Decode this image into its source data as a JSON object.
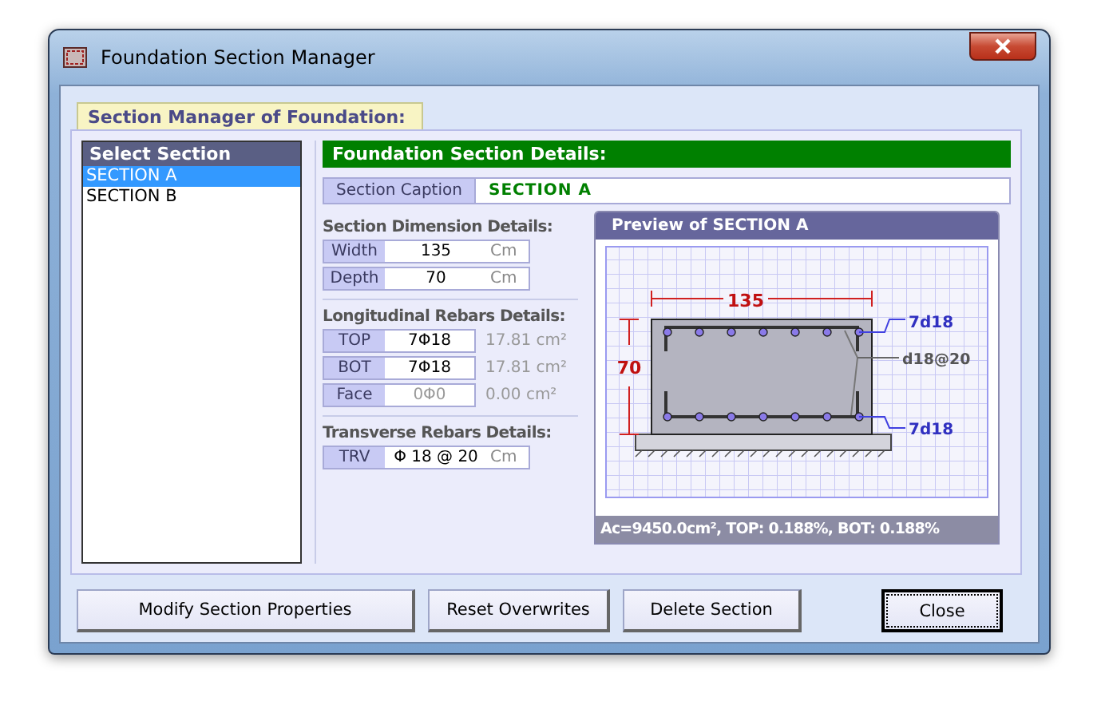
{
  "window": {
    "title": "Foundation Section Manager"
  },
  "group_tab": {
    "label": "Section Manager of Foundation:"
  },
  "section_list": {
    "heading": "Select Section",
    "items": [
      {
        "label": "SECTION A",
        "selected": true
      },
      {
        "label": "SECTION B",
        "selected": false
      }
    ]
  },
  "details": {
    "heading": "Foundation Section Details:",
    "caption_label": "Section Caption",
    "caption_value": "SECTION A",
    "groups": [
      {
        "title": "Section Dimension Details:",
        "rows": [
          {
            "label": "Width",
            "value": "135",
            "unit": "Cm",
            "disabled": false
          },
          {
            "label": "Depth",
            "value": "70",
            "unit": "Cm",
            "disabled": false
          }
        ]
      },
      {
        "title": "Longitudinal Rebars Details:",
        "rows": [
          {
            "label": "TOP",
            "value": "7Φ18",
            "area": "17.81 cm²",
            "disabled": false
          },
          {
            "label": "BOT",
            "value": "7Φ18",
            "area": "17.81 cm²",
            "disabled": false
          },
          {
            "label": "Face",
            "value": "0Φ0",
            "area": "0.00 cm²",
            "disabled": true
          }
        ]
      },
      {
        "title": "Transverse Rebars Details:",
        "rows": [
          {
            "label": "TRV",
            "value": "Φ 18 @ 20",
            "unit": "Cm",
            "disabled": false
          }
        ]
      }
    ]
  },
  "preview": {
    "title": "Preview of SECTION A",
    "width_label": "135",
    "depth_label": "70",
    "top_label": "7d18",
    "stirrup_label": "d18@20",
    "bottom_label": "7d18",
    "summary": "Ac=9450.0cm², TOP: 0.188%, BOT: 0.188%"
  },
  "buttons": [
    {
      "label": "Modify Section Properties",
      "default": false
    },
    {
      "label": "Reset Overwrites",
      "default": false
    },
    {
      "label": "Delete Section",
      "default": false
    },
    {
      "label": "Close",
      "default": true
    }
  ]
}
